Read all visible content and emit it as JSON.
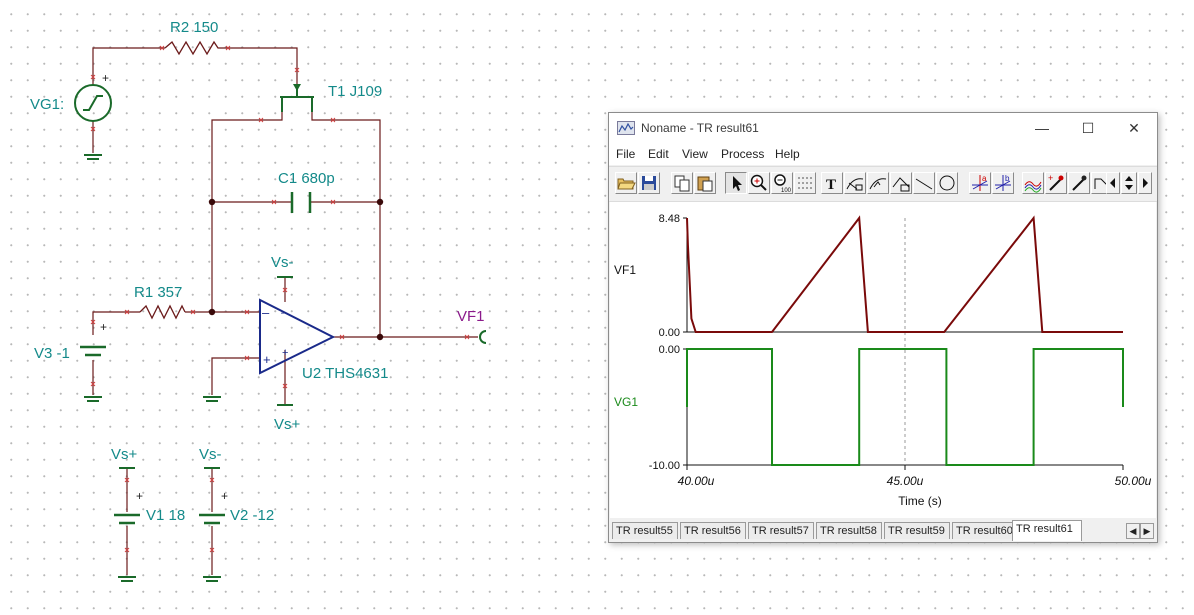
{
  "schematic": {
    "r2": "R2 150",
    "t1": "T1 J109",
    "vg1": "VG1:",
    "c1": "C1 680p",
    "r1": "R1 357",
    "v3": "V3 -1",
    "u2": "U2 THS4631",
    "vf1": "VF1",
    "vs_minus": "Vs-",
    "vs_plus": "Vs+",
    "v1": "V1 18",
    "v2": "V2 -12",
    "plus": "+",
    "minus": "–"
  },
  "window": {
    "title": "Noname - TR result61",
    "minimize": "—",
    "maximize": "☐",
    "close": "✕",
    "menu": [
      "File",
      "Edit",
      "View",
      "Process",
      "Help"
    ],
    "toolbar_icons": [
      "open-icon",
      "save-icon",
      "copy-icon",
      "paste-icon",
      "pointer-icon",
      "zoom-in-icon",
      "zoom-100-icon",
      "grid-icon",
      "text-icon",
      "curve-label-icon",
      "curve-label-2-icon",
      "curve-label-3-icon",
      "line-icon",
      "circle-icon",
      "cursor-a-icon",
      "cursor-b-icon",
      "curves-icon",
      "probe-icon",
      "marker-icon",
      "scroll-left-icon",
      "scroll-up-down-icon",
      "scroll-right-icon"
    ],
    "tabs": [
      "TR result55",
      "TR result56",
      "TR result57",
      "TR result58",
      "TR result59",
      "TR result60",
      "TR result61"
    ],
    "active_tab": "TR result61"
  },
  "chart_data": [
    {
      "type": "line",
      "ylabel": "VF1",
      "ylim": [
        0.0,
        8.48
      ],
      "ytick_labels": [
        "8.48",
        "0.00"
      ],
      "series": [
        {
          "name": "VF1",
          "color": "#7a0a0a",
          "x": [
            40.0,
            40.02,
            40.1,
            40.2,
            41.95,
            43.95,
            44.15,
            45.9,
            47.95,
            48.15,
            50.0
          ],
          "y": [
            8.48,
            6.5,
            1.0,
            0.0,
            0.0,
            8.48,
            0.0,
            0.0,
            8.48,
            0.0,
            0.0
          ]
        }
      ]
    },
    {
      "type": "line",
      "ylabel": "VG1",
      "ylim": [
        -10.0,
        0.0
      ],
      "ytick_labels": [
        "0.00",
        "-10.00"
      ],
      "series": [
        {
          "name": "VG1",
          "color": "#1a8a1a",
          "x": [
            40.0,
            40.0,
            41.95,
            41.95,
            43.95,
            43.95,
            45.95,
            45.95,
            47.95,
            47.95,
            50.0,
            50.0
          ],
          "y": [
            -5.0,
            0.0,
            0.0,
            -10.0,
            -10.0,
            0.0,
            0.0,
            -10.0,
            -10.0,
            0.0,
            0.0,
            -5.0
          ]
        }
      ]
    }
  ],
  "xaxis": {
    "label": "Time (s)",
    "xlim": [
      40.0,
      50.0
    ],
    "tick_labels": [
      "40.00u",
      "45.00u",
      "50.00u"
    ],
    "tick_values": [
      40.0,
      45.0,
      50.0
    ]
  }
}
